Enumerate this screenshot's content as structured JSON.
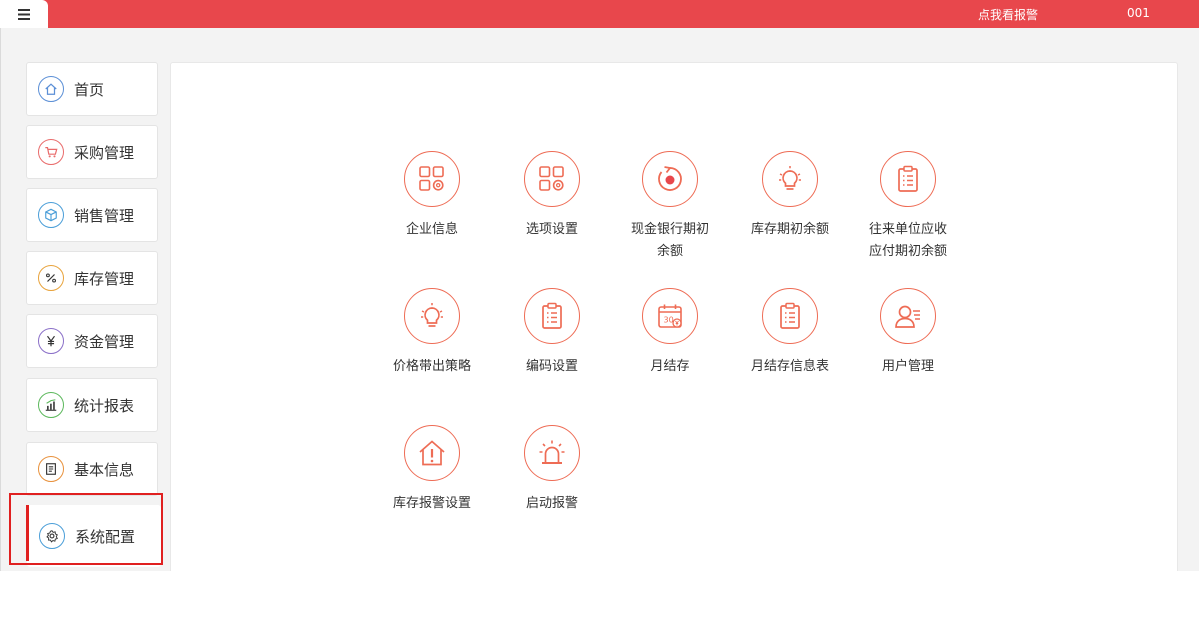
{
  "header": {
    "menu_icon": "hamburger-icon",
    "alarm_link": "点我看报警",
    "user_code": "001",
    "bar_color": "#e8474c"
  },
  "sidebar": {
    "items": [
      {
        "label": "首页",
        "icon": "home-icon",
        "color": "#5b8fd6"
      },
      {
        "label": "采购管理",
        "icon": "cart-icon",
        "color": "#e96b6b"
      },
      {
        "label": "销售管理",
        "icon": "box-icon",
        "color": "#4a9ed8"
      },
      {
        "label": "库存管理",
        "icon": "percent-icon",
        "color": "#e8a33c"
      },
      {
        "label": "资金管理",
        "icon": "yuan-icon",
        "color": "#8a6fc8"
      },
      {
        "label": "统计报表",
        "icon": "chart-icon",
        "color": "#5cb85c"
      },
      {
        "label": "基本信息",
        "icon": "document-icon",
        "color": "#e8913c"
      },
      {
        "label": "系统配置",
        "icon": "gear-icon",
        "color": "#4a9ed8"
      }
    ],
    "selected": "系统配置",
    "highlight_color": "#e02020"
  },
  "main": {
    "accent_color": "#ee6c55",
    "tiles": [
      {
        "label": "企业信息",
        "icon": "grid-gear-icon"
      },
      {
        "label": "选项设置",
        "icon": "grid-gear-icon"
      },
      {
        "label": "现金银行期初\n余额",
        "icon": "circular-arrow-icon"
      },
      {
        "label": "库存期初余额",
        "icon": "lightbulb-icon"
      },
      {
        "label": "往来单位应收\n应付期初余额",
        "icon": "clipboard-icon"
      },
      {
        "label": "价格带出策略",
        "icon": "lightbulb-icon"
      },
      {
        "label": "编码设置",
        "icon": "clipboard-icon"
      },
      {
        "label": "月结存",
        "icon": "calendar-icon",
        "calendar_day": "30"
      },
      {
        "label": "月结存信息表",
        "icon": "clipboard-icon"
      },
      {
        "label": "用户管理",
        "icon": "user-icon"
      },
      {
        "label": "库存报警设置",
        "icon": "house-alert-icon"
      },
      {
        "label": "启动报警",
        "icon": "alarm-light-icon"
      }
    ]
  }
}
